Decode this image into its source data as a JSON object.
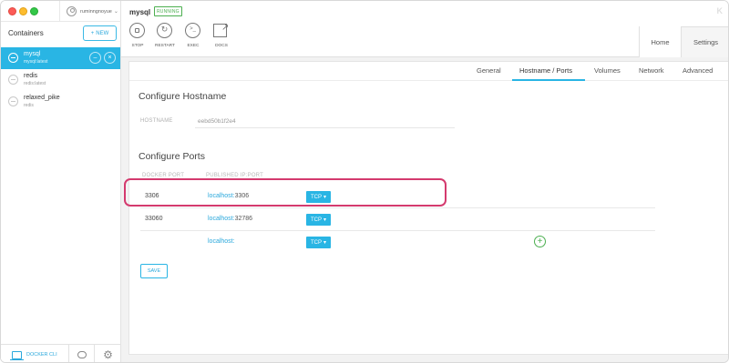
{
  "user": {
    "name": "ruminngnoyue"
  },
  "sidebar": {
    "title": "Containers",
    "new_label": "NEW",
    "items": [
      {
        "name": "mysql",
        "image": "mysql:latest",
        "active": true
      },
      {
        "name": "redis",
        "image": "redis:latest",
        "active": false
      },
      {
        "name": "relaxed_pike",
        "image": "redis",
        "active": false
      }
    ],
    "footer": {
      "cli_label": "DOCKER CLI"
    }
  },
  "header": {
    "container_name": "mysql",
    "status": "RUNNING",
    "tools": [
      {
        "label": "STOP",
        "icon": "stop-icon"
      },
      {
        "label": "RESTART",
        "icon": "restart-icon"
      },
      {
        "label": "EXEC",
        "icon": "exec-icon"
      },
      {
        "label": "DOCS",
        "icon": "docs-icon"
      }
    ],
    "tabs": {
      "home": "Home",
      "settings": "Settings"
    }
  },
  "subtabs": [
    "General",
    "Hostname / Ports",
    "Volumes",
    "Network",
    "Advanced"
  ],
  "active_subtab": "Hostname / Ports",
  "hostname": {
    "title": "Configure Hostname",
    "label": "HOSTNAME",
    "value": "eebd50b1f2e4"
  },
  "ports": {
    "title": "Configure Ports",
    "col_docker": "DOCKER PORT",
    "col_published": "PUBLISHED IP:PORT",
    "rows": [
      {
        "docker_port": "3306",
        "host": "localhost",
        "sep": ":",
        "port": "3306",
        "protocol": "TCP"
      },
      {
        "docker_port": "33060",
        "host": "localhost",
        "sep": ":",
        "port": "32786",
        "protocol": "TCP"
      },
      {
        "docker_port": "",
        "host": "localhost",
        "sep": ":",
        "port": "",
        "protocol": "TCP"
      }
    ],
    "save_label": "SAVE"
  },
  "colors": {
    "accent": "#29b5e4",
    "running": "#4caf50",
    "highlight": "#d43a6e"
  }
}
